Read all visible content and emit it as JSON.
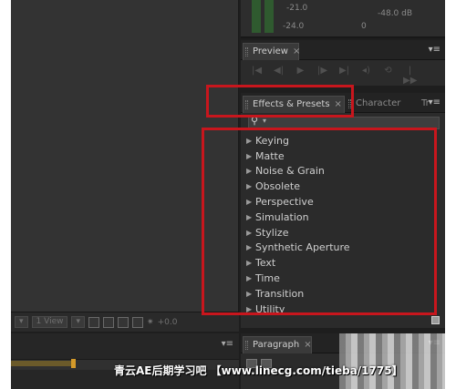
{
  "top_caption": "",
  "audio": {
    "values": [
      "-21.0",
      "-24.0",
      "-48.0 dB",
      "0"
    ]
  },
  "preview_panel": {
    "tab_label": "Preview",
    "close_glyph": "×",
    "menu_glyph": "▾≡",
    "controls": [
      "first-frame-icon",
      "prev-frame-icon",
      "play-icon",
      "next-frame-icon",
      "last-frame-icon",
      "audio-icon",
      "loop-icon",
      "ram-preview-icon"
    ]
  },
  "effects_panel": {
    "tabs": [
      {
        "label": "Effects & Presets",
        "active": true
      },
      {
        "label": "Character",
        "active": false
      },
      {
        "label": "Tr",
        "active": false
      }
    ],
    "close_glyph": "×",
    "menu_glyph": "▾≡",
    "search": {
      "icon": "magnifier-icon",
      "value": ""
    },
    "categories": [
      "Keying",
      "Matte",
      "Noise & Grain",
      "Obsolete",
      "Perspective",
      "Simulation",
      "Stylize",
      "Synthetic Aperture",
      "Text",
      "Time",
      "Transition",
      "Utility"
    ]
  },
  "composition_bar": {
    "view_menu": "1 View",
    "zoom": "+0.0"
  },
  "timeline": {
    "menu_glyph": "▾≡"
  },
  "paragraph_panel": {
    "tab_label": "Paragraph",
    "close_glyph": "×",
    "menu_glyph": "▾≡"
  },
  "watermark": "青云AE后期学习吧 【www.linecg.com/tieba/1775】",
  "colors": {
    "highlight": "#c8161d",
    "panel_bg": "#2b2b2b",
    "text": "#cfcfcf"
  }
}
